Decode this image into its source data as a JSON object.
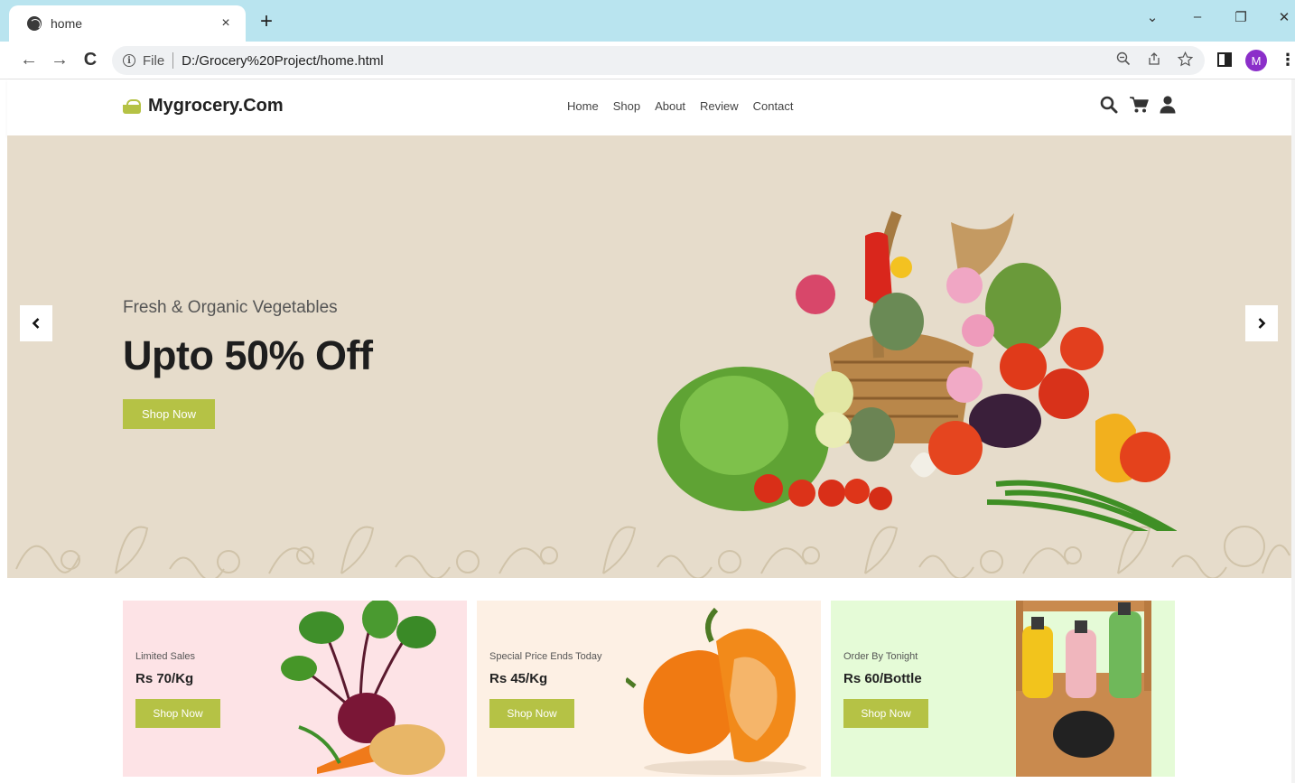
{
  "browser": {
    "tab_title": "home",
    "tab_close": "×",
    "new_tab": "+",
    "window_controls": [
      "⌄",
      "–",
      "❐",
      "✕"
    ],
    "nav_buttons": [
      "←",
      "→",
      "C"
    ],
    "address_scheme": "File",
    "address_url": "D:/Grocery%20Project/home.html",
    "profile_initial": "M"
  },
  "site": {
    "logo_text": "Mygrocery.Com",
    "nav": [
      "Home",
      "Shop",
      "About",
      "Review",
      "Contact"
    ],
    "icons": [
      "search-icon",
      "cart-icon",
      "user-icon"
    ]
  },
  "hero": {
    "subtitle": "Fresh & Organic Vegetables",
    "title": "Upto 50% Off",
    "button": "Shop Now"
  },
  "cards": [
    {
      "tag": "Limited Sales",
      "price": "Rs 70/Kg",
      "button": "Shop Now",
      "bg": "#fde3e6",
      "image": "beetroot-carrot-potato"
    },
    {
      "tag": "Special Price Ends Today",
      "price": "Rs 45/Kg",
      "button": "Shop Now",
      "bg": "#fdf0e4",
      "image": "orange-bell-pepper"
    },
    {
      "tag": "Order By Tonight",
      "price": "Rs 60/Bottle",
      "button": "Shop Now",
      "bg": "#e5fbd7",
      "image": "smooth-fruit-juice-bottles"
    }
  ],
  "colors": {
    "accent": "#b5c245",
    "hero_bg": "#e6dccb",
    "tabstrip": "#b9e4ef",
    "profile": "#8b2fc9"
  }
}
